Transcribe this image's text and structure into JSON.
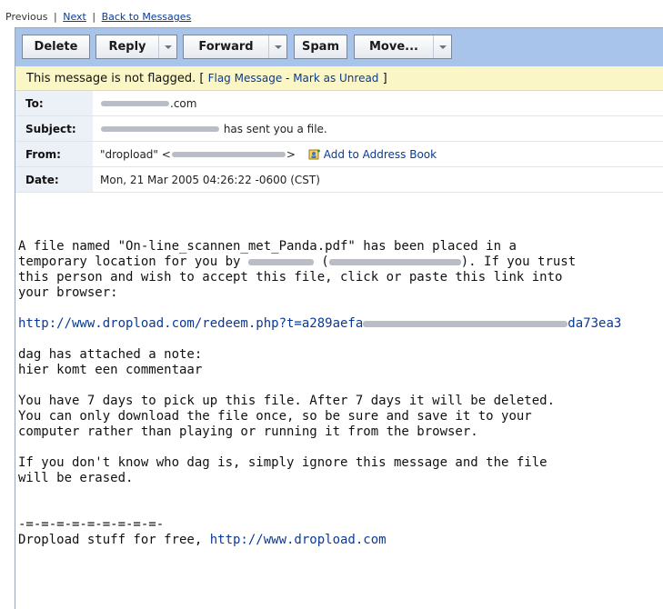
{
  "nav": {
    "previous": "Previous",
    "sep": "|",
    "next": "Next",
    "back": "Back to Messages"
  },
  "toolbar": {
    "delete": "Delete",
    "reply": "Reply",
    "forward": "Forward",
    "spam": "Spam",
    "move": "Move..."
  },
  "flag": {
    "status": "This message is not flagged.",
    "open": "[",
    "flag_link": "Flag Message",
    "dash": " - ",
    "unread_link": "Mark as Unread",
    "close": "]"
  },
  "headers": {
    "to_label": "To:",
    "to_domain": ".com",
    "subject_label": "Subject:",
    "subject_suffix": "has sent you a file.",
    "from_label": "From:",
    "from_name": "\"dropload\" <",
    "from_close": ">",
    "add_book": "Add to Address Book",
    "date_label": "Date:",
    "date_value": "Mon, 21 Mar 2005 04:26:22 -0600 (CST)"
  },
  "message": {
    "l1": "A file named \"On-line_scannen_met_Panda.pdf\" has been placed in a",
    "l2a": "temporary location for you by ",
    "l2b": " (",
    "l2c": "). If you trust",
    "l3": "this person and wish to accept this file, click or paste this link into",
    "l4": "your browser:",
    "link_a": "http://www.dropload.com/redeem.php?t=a289aefa",
    "link_b": "da73ea3",
    "note1": "dag has attached a note:",
    "note2": "hier komt een commentaar",
    "p3_1": "You have 7 days to pick up this file. After 7 days it will be deleted.",
    "p3_2": "You can only download the file once, so be sure and save it to your",
    "p3_3": "computer rather than playing or running it from the browser.",
    "p4_1": "If you don't know who dag is, simply ignore this message and the file",
    "p4_2": "will be erased.",
    "divider": "-=-=-=-=-=-=-=-=-=-",
    "footer": "Dropload stuff for free, ",
    "footer_link": "http://www.dropload.com"
  }
}
